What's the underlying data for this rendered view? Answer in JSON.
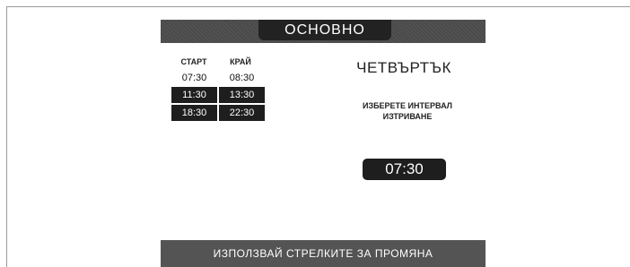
{
  "header": {
    "title": "ОСНОВНО"
  },
  "schedule": {
    "start_label": "СТАРТ",
    "end_label": "КРАЙ",
    "rows": [
      {
        "start": "07:30",
        "end": "08:30",
        "selected": false
      },
      {
        "start": "11:30",
        "end": "13:30",
        "selected": true
      },
      {
        "start": "18:30",
        "end": "22:30",
        "selected": true
      }
    ]
  },
  "day": "ЧЕТВЪРТЪК",
  "instruction": {
    "line1": "ИЗБЕРЕТЕ ИНТЕРВАЛ",
    "line2": "ИЗТРИВАНЕ"
  },
  "selected_time": "07:30",
  "footer": {
    "hint": "ИЗПОЛЗВАЙ СТРЕЛКИТЕ ЗА ПРОМЯНА"
  },
  "colors": {
    "dark": "#1e1e1e",
    "bar": "#545454"
  }
}
